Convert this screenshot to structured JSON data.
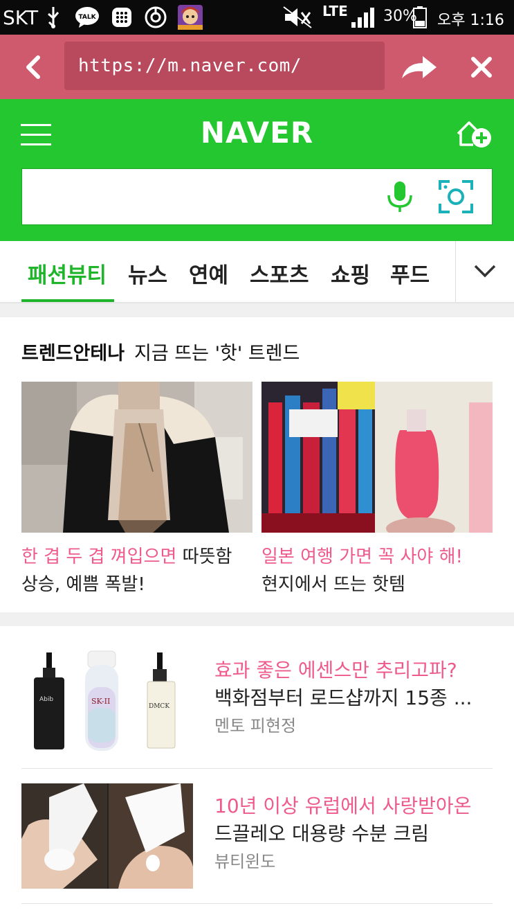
{
  "status_bar": {
    "carrier": "SKT",
    "talk_label": "TALK",
    "network": "LTE",
    "battery": "30%",
    "time": "오후 1:16"
  },
  "browser": {
    "url": "https://m.naver.com/",
    "back_icon": "chevron-left-icon",
    "share_icon": "share-arrow-icon",
    "close_icon": "close-icon"
  },
  "naver": {
    "logo": "NAVER",
    "menu_icon": "hamburger-icon",
    "home_add_icon": "home-plus-icon",
    "search_placeholder": "",
    "voice_icon": "microphone-icon",
    "lens_icon": "camera-lens-icon",
    "accent_color": "#24c72f"
  },
  "tabs": [
    {
      "label": "패션뷰티",
      "active": true
    },
    {
      "label": "뉴스",
      "active": false
    },
    {
      "label": "연예",
      "active": false
    },
    {
      "label": "스포츠",
      "active": false
    },
    {
      "label": "쇼핑",
      "active": false
    },
    {
      "label": "푸드",
      "active": false
    }
  ],
  "trend": {
    "title": "트렌드안테나",
    "subtitle": "지금 뜨는 '핫' 트렌드",
    "cards": [
      {
        "highlight": "한 겹 두 겹 껴입으면",
        "text1": " 따뜻함",
        "text2": "상승, 예쁨 폭발!"
      },
      {
        "highlight": "일본 여행 가면 꼭 사야 해!",
        "text1": "",
        "text2": "현지에서 뜨는 핫템"
      }
    ]
  },
  "list": [
    {
      "title": "효과 좋은 에센스만 추리고파?",
      "subtitle": "백화점부터 로드샵까지 15종 ...",
      "source": "멘토 피현정",
      "labels": [
        "Abib",
        "SK-II",
        "DMCK"
      ]
    },
    {
      "title": "10년 이상 유럽에서 사랑받아온",
      "subtitle": "드끌레오 대용량 수분 크림",
      "source": "뷰티윈도"
    }
  ]
}
